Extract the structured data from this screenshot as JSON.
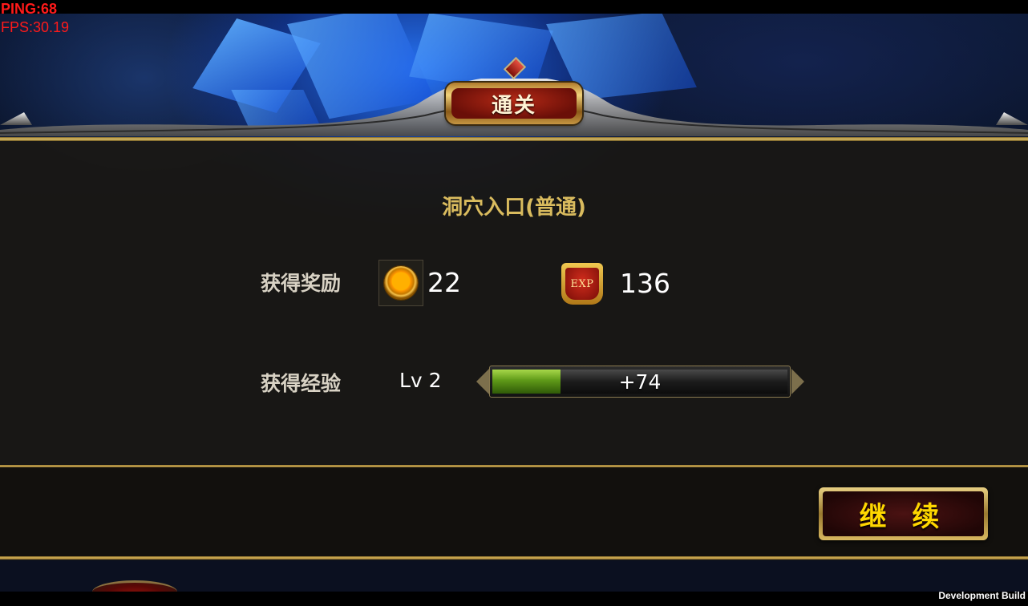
{
  "debug": {
    "ping": "PING:68",
    "fps": "FPS:30.19",
    "build_label": "Development Build"
  },
  "dialog": {
    "title": "通关",
    "stage_name": "洞穴入口(普通)",
    "rewards": {
      "label": "获得奖励",
      "gold_icon": "gold-coin-icon",
      "gold_amount": "22",
      "exp_icon": "exp-badge-icon",
      "exp_icon_text": "EXP",
      "exp_amount": "136"
    },
    "experience": {
      "label": "获得经验",
      "level_text": "Lv 2",
      "gain_text": "+74",
      "progress_fraction": 0.23
    },
    "continue_button": "继 续"
  },
  "colors": {
    "accent_gold": "#d9bb5e",
    "button_text": "#ffd700",
    "xp_fill": "#5f9a18",
    "debug_text": "#ff1a1a"
  }
}
